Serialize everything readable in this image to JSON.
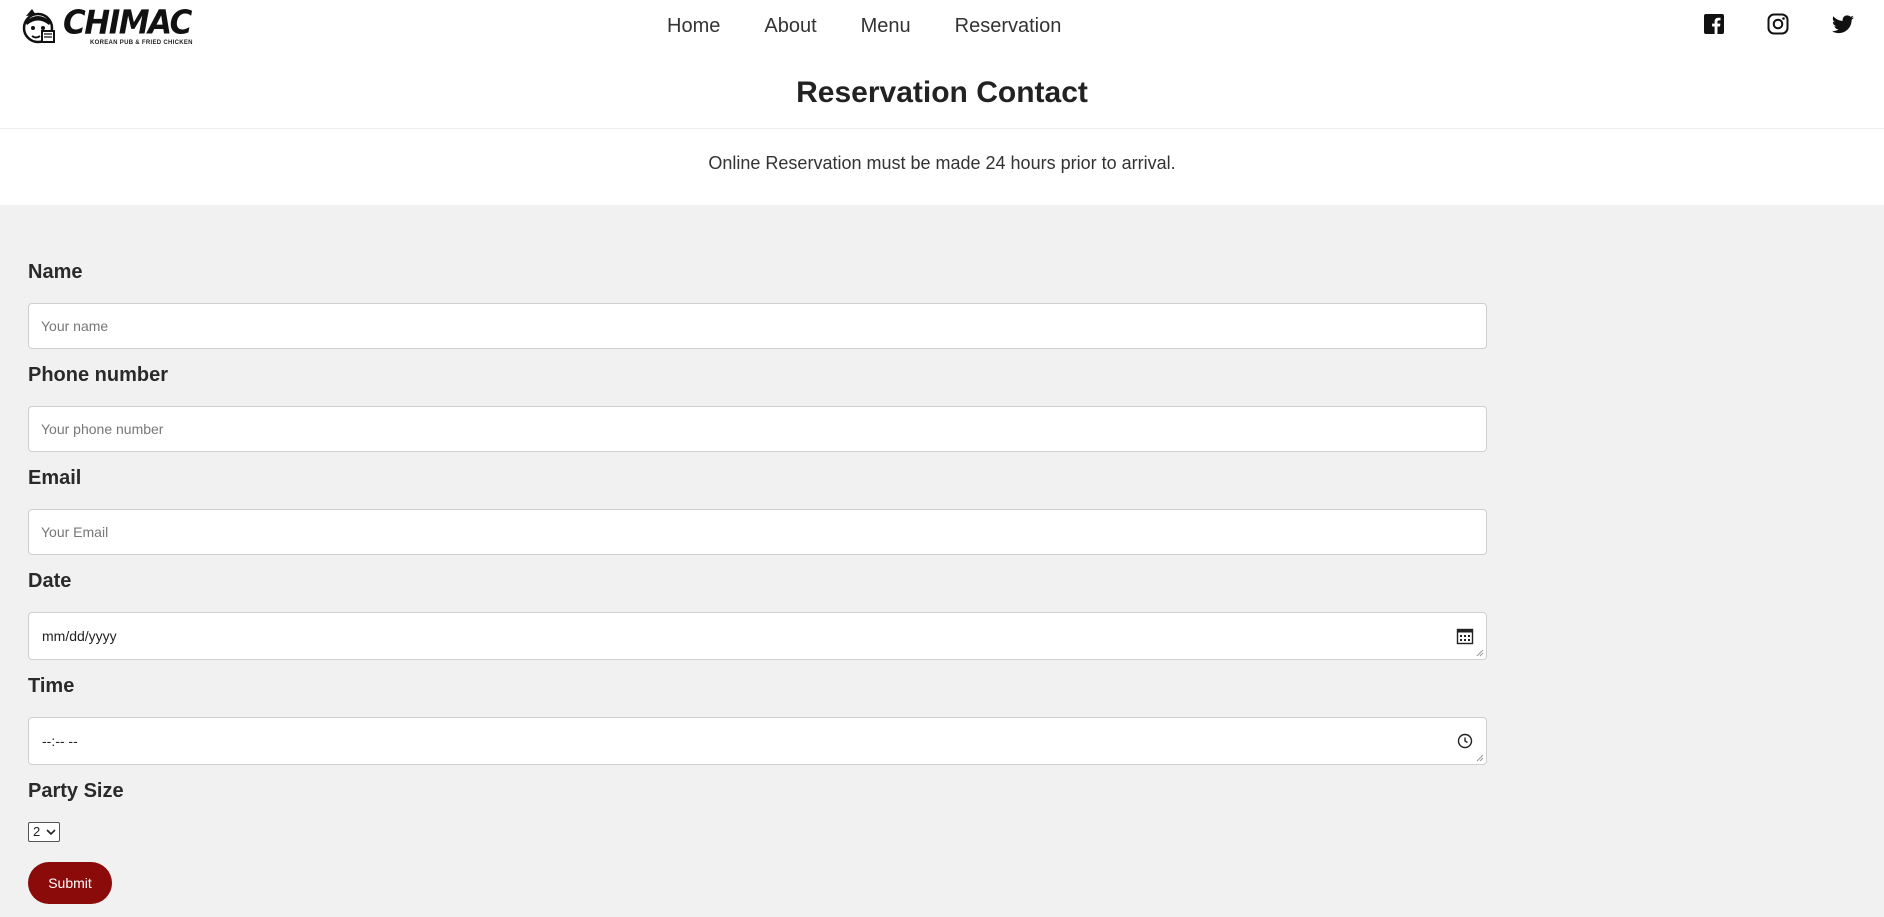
{
  "brand": {
    "name": "CHIMAC",
    "tagline": "KOREAN PUB & FRIED CHICKEN"
  },
  "nav": {
    "items": [
      "Home",
      "About",
      "Menu",
      "Reservation"
    ]
  },
  "social": {
    "icons": [
      "facebook-icon",
      "instagram-icon",
      "twitter-icon"
    ]
  },
  "page": {
    "title": "Reservation Contact",
    "notice": "Online Reservation must be made 24 hours prior to arrival."
  },
  "form": {
    "name": {
      "label": "Name",
      "placeholder": "Your name"
    },
    "phone": {
      "label": "Phone number",
      "placeholder": "Your phone number"
    },
    "email": {
      "label": "Email",
      "placeholder": "Your Email"
    },
    "date": {
      "label": "Date",
      "value": "mm/dd/yyyy"
    },
    "time": {
      "label": "Time",
      "value": "--:-- --"
    },
    "party_size": {
      "label": "Party Size",
      "selected": "2"
    },
    "submit_label": "Submit"
  },
  "colors": {
    "accent": "#8b0a0a",
    "form_background": "#f1f1f1"
  }
}
